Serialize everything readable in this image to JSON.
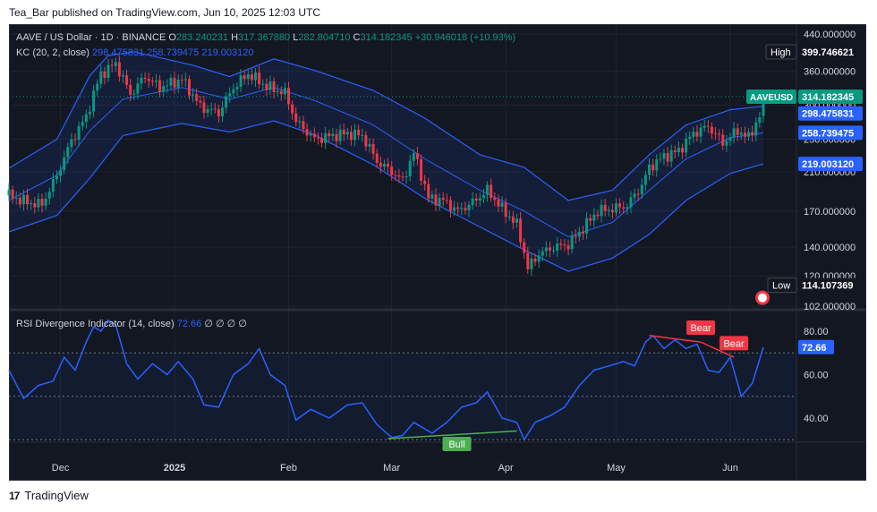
{
  "header": {
    "published": "Tea_Bar published on TradingView.com, Jun 10, 2025 12:03 UTC"
  },
  "main_legend": {
    "symbol": "AAVE / US Dollar · 1D · BINANCE",
    "o_label": "O",
    "o": "283.240231",
    "h_label": "H",
    "h": "317.367880",
    "l_label": "L",
    "l": "282.804710",
    "c_label": "C",
    "c": "314.182345",
    "change": "+30.946018 (+10.93%)",
    "kc_label": "KC (20, 2, close)",
    "kc_upper": "298.475831",
    "kc_mid": "258.739475",
    "kc_lower": "219.003120"
  },
  "rsi_legend": {
    "label": "RSI Divergence Indicator (14, close)",
    "value": "72.66",
    "extras": "∅ ∅ ∅ ∅"
  },
  "badges": {
    "high_label": "High",
    "high_value": "399.746621",
    "symbol_tag": "AAVEUSD",
    "last_price": "314.182345",
    "kc_upper": "298.475831",
    "kc_mid": "258.739475",
    "kc_lower": "219.003120",
    "low_label": "Low",
    "low_value": "114.107369",
    "rsi_value": "72.66"
  },
  "annotations": {
    "bull": "Bull",
    "bear1": "Bear",
    "bear2": "Bear"
  },
  "colors": {
    "up": "#089981",
    "down": "#f23645",
    "kc": "#2962ff",
    "bg": "#131722",
    "grid": "#1f2330",
    "rsi": "#2962ff"
  },
  "footer": {
    "brand": "TradingView",
    "logo_text": "17"
  },
  "chart_data": [
    {
      "type": "candlestick",
      "title": "AAVE / US Dollar · 1D · BINANCE",
      "y_scale": "log",
      "y_ticks": [
        102,
        120,
        140,
        170,
        210,
        250,
        300,
        360,
        440
      ],
      "y_tick_labels": [
        "102.000000",
        "120.000000",
        "140.000000",
        "170.000000",
        "210.000000",
        "250.000000",
        "300.000000",
        "360.000000",
        "440.000000"
      ],
      "x_ticks": [
        {
          "label": "Dec",
          "date": "2024-12-01"
        },
        {
          "label": "2025",
          "date": "2025-01-01"
        },
        {
          "label": "Feb",
          "date": "2025-02-01"
        },
        {
          "label": "Mar",
          "date": "2025-03-01"
        },
        {
          "label": "Apr",
          "date": "2025-04-01"
        },
        {
          "label": "May",
          "date": "2025-05-01"
        },
        {
          "label": "Jun",
          "date": "2025-06-01"
        }
      ],
      "x_range": [
        "2024-11-17",
        "2025-06-19"
      ],
      "close_path": [
        {
          "date": "2024-11-17",
          "close": 185
        },
        {
          "date": "2024-11-22",
          "close": 178
        },
        {
          "date": "2024-11-26",
          "close": 176
        },
        {
          "date": "2024-11-30",
          "close": 205
        },
        {
          "date": "2024-12-04",
          "close": 248
        },
        {
          "date": "2024-12-08",
          "close": 282
        },
        {
          "date": "2024-12-12",
          "close": 355
        },
        {
          "date": "2024-12-16",
          "close": 375
        },
        {
          "date": "2024-12-20",
          "close": 318
        },
        {
          "date": "2024-12-24",
          "close": 350
        },
        {
          "date": "2024-12-28",
          "close": 330
        },
        {
          "date": "2025-01-03",
          "close": 345
        },
        {
          "date": "2025-01-08",
          "close": 298
        },
        {
          "date": "2025-01-13",
          "close": 288
        },
        {
          "date": "2025-01-17",
          "close": 330
        },
        {
          "date": "2025-01-21",
          "close": 355
        },
        {
          "date": "2025-01-26",
          "close": 332
        },
        {
          "date": "2025-01-31",
          "close": 320
        },
        {
          "date": "2025-02-03",
          "close": 275
        },
        {
          "date": "2025-02-08",
          "close": 250
        },
        {
          "date": "2025-02-13",
          "close": 255
        },
        {
          "date": "2025-02-17",
          "close": 258
        },
        {
          "date": "2025-02-21",
          "close": 255
        },
        {
          "date": "2025-02-25",
          "close": 222
        },
        {
          "date": "2025-03-01",
          "close": 210
        },
        {
          "date": "2025-03-04",
          "close": 200
        },
        {
          "date": "2025-03-07",
          "close": 232
        },
        {
          "date": "2025-03-11",
          "close": 182
        },
        {
          "date": "2025-03-15",
          "close": 180
        },
        {
          "date": "2025-03-19",
          "close": 170
        },
        {
          "date": "2025-03-23",
          "close": 178
        },
        {
          "date": "2025-03-27",
          "close": 190
        },
        {
          "date": "2025-03-31",
          "close": 172
        },
        {
          "date": "2025-04-04",
          "close": 158
        },
        {
          "date": "2025-04-07",
          "close": 125
        },
        {
          "date": "2025-04-10",
          "close": 135
        },
        {
          "date": "2025-04-14",
          "close": 140
        },
        {
          "date": "2025-04-18",
          "close": 142
        },
        {
          "date": "2025-04-22",
          "close": 155
        },
        {
          "date": "2025-04-26",
          "close": 170
        },
        {
          "date": "2025-04-30",
          "close": 172
        },
        {
          "date": "2025-05-04",
          "close": 175
        },
        {
          "date": "2025-05-08",
          "close": 195
        },
        {
          "date": "2025-05-10",
          "close": 215
        },
        {
          "date": "2025-05-14",
          "close": 228
        },
        {
          "date": "2025-05-18",
          "close": 235
        },
        {
          "date": "2025-05-22",
          "close": 258
        },
        {
          "date": "2025-05-26",
          "close": 268
        },
        {
          "date": "2025-05-30",
          "close": 245
        },
        {
          "date": "2025-06-03",
          "close": 262
        },
        {
          "date": "2025-06-06",
          "close": 252
        },
        {
          "date": "2025-06-09",
          "close": 283
        },
        {
          "date": "2025-06-10",
          "close": 314
        }
      ],
      "kc_upper_path": [
        {
          "date": "2024-11-17",
          "value": 214
        },
        {
          "date": "2024-11-30",
          "value": 250
        },
        {
          "date": "2024-12-09",
          "value": 352
        },
        {
          "date": "2024-12-14",
          "value": 392
        },
        {
          "date": "2024-12-21",
          "value": 400
        },
        {
          "date": "2025-01-06",
          "value": 372
        },
        {
          "date": "2025-01-16",
          "value": 350
        },
        {
          "date": "2025-01-28",
          "value": 385
        },
        {
          "date": "2025-02-08",
          "value": 362
        },
        {
          "date": "2025-02-24",
          "value": 325
        },
        {
          "date": "2025-03-10",
          "value": 280
        },
        {
          "date": "2025-03-25",
          "value": 230
        },
        {
          "date": "2025-04-06",
          "value": 215
        },
        {
          "date": "2025-04-18",
          "value": 180
        },
        {
          "date": "2025-04-30",
          "value": 190
        },
        {
          "date": "2025-05-10",
          "value": 230
        },
        {
          "date": "2025-05-20",
          "value": 270
        },
        {
          "date": "2025-06-01",
          "value": 293
        },
        {
          "date": "2025-06-10",
          "value": 298.48
        }
      ],
      "kc_mid_path": [
        {
          "date": "2024-11-17",
          "value": 180
        },
        {
          "date": "2024-11-30",
          "value": 206
        },
        {
          "date": "2024-12-09",
          "value": 262
        },
        {
          "date": "2024-12-18",
          "value": 310
        },
        {
          "date": "2025-01-03",
          "value": 330
        },
        {
          "date": "2025-01-16",
          "value": 310
        },
        {
          "date": "2025-01-28",
          "value": 330
        },
        {
          "date": "2025-02-08",
          "value": 308
        },
        {
          "date": "2025-02-24",
          "value": 270
        },
        {
          "date": "2025-03-10",
          "value": 225
        },
        {
          "date": "2025-03-25",
          "value": 190
        },
        {
          "date": "2025-04-06",
          "value": 170
        },
        {
          "date": "2025-04-18",
          "value": 148
        },
        {
          "date": "2025-04-30",
          "value": 160
        },
        {
          "date": "2025-05-10",
          "value": 190
        },
        {
          "date": "2025-05-20",
          "value": 225
        },
        {
          "date": "2025-06-01",
          "value": 252
        },
        {
          "date": "2025-06-10",
          "value": 258.74
        }
      ],
      "kc_lower_path": [
        {
          "date": "2024-11-17",
          "value": 152
        },
        {
          "date": "2024-11-30",
          "value": 166
        },
        {
          "date": "2024-12-09",
          "value": 203
        },
        {
          "date": "2024-12-18",
          "value": 255
        },
        {
          "date": "2025-01-03",
          "value": 272
        },
        {
          "date": "2025-01-16",
          "value": 260
        },
        {
          "date": "2025-01-28",
          "value": 276
        },
        {
          "date": "2025-02-08",
          "value": 256
        },
        {
          "date": "2025-02-24",
          "value": 218
        },
        {
          "date": "2025-03-10",
          "value": 182
        },
        {
          "date": "2025-03-25",
          "value": 156
        },
        {
          "date": "2025-04-06",
          "value": 138
        },
        {
          "date": "2025-04-18",
          "value": 123
        },
        {
          "date": "2025-04-30",
          "value": 132
        },
        {
          "date": "2025-05-10",
          "value": 150
        },
        {
          "date": "2025-05-20",
          "value": 180
        },
        {
          "date": "2025-06-01",
          "value": 208
        },
        {
          "date": "2025-06-10",
          "value": 219.0
        }
      ],
      "high": 399.746621,
      "low": 114.107369,
      "last": 314.182345
    },
    {
      "type": "line",
      "title": "RSI Divergence Indicator (14, close)",
      "ylim": [
        25,
        87
      ],
      "y_ticks": [
        40,
        60,
        80
      ],
      "y_tick_labels": [
        "40.00",
        "60.00",
        "80.00"
      ],
      "bands": [
        30,
        50,
        70
      ],
      "rsi_path": [
        {
          "date": "2024-11-17",
          "value": 62
        },
        {
          "date": "2024-11-21",
          "value": 49
        },
        {
          "date": "2024-11-25",
          "value": 55
        },
        {
          "date": "2024-11-29",
          "value": 57
        },
        {
          "date": "2024-12-02",
          "value": 68
        },
        {
          "date": "2024-12-05",
          "value": 62
        },
        {
          "date": "2024-12-08",
          "value": 75
        },
        {
          "date": "2024-12-10",
          "value": 82
        },
        {
          "date": "2024-12-12",
          "value": 80
        },
        {
          "date": "2024-12-14",
          "value": 85
        },
        {
          "date": "2024-12-16",
          "value": 83
        },
        {
          "date": "2024-12-19",
          "value": 65
        },
        {
          "date": "2024-12-22",
          "value": 58
        },
        {
          "date": "2024-12-26",
          "value": 65
        },
        {
          "date": "2024-12-30",
          "value": 60
        },
        {
          "date": "2025-01-02",
          "value": 66
        },
        {
          "date": "2025-01-06",
          "value": 58
        },
        {
          "date": "2025-01-09",
          "value": 46
        },
        {
          "date": "2025-01-13",
          "value": 45
        },
        {
          "date": "2025-01-17",
          "value": 60
        },
        {
          "date": "2025-01-21",
          "value": 65
        },
        {
          "date": "2025-01-24",
          "value": 72
        },
        {
          "date": "2025-01-27",
          "value": 60
        },
        {
          "date": "2025-01-31",
          "value": 55
        },
        {
          "date": "2025-02-03",
          "value": 39
        },
        {
          "date": "2025-02-07",
          "value": 44
        },
        {
          "date": "2025-02-12",
          "value": 40
        },
        {
          "date": "2025-02-17",
          "value": 46
        },
        {
          "date": "2025-02-21",
          "value": 47
        },
        {
          "date": "2025-02-25",
          "value": 37
        },
        {
          "date": "2025-03-01",
          "value": 31
        },
        {
          "date": "2025-03-04",
          "value": 32
        },
        {
          "date": "2025-03-07",
          "value": 38
        },
        {
          "date": "2025-03-12",
          "value": 33
        },
        {
          "date": "2025-03-16",
          "value": 38
        },
        {
          "date": "2025-03-20",
          "value": 45
        },
        {
          "date": "2025-03-24",
          "value": 47
        },
        {
          "date": "2025-03-27",
          "value": 52
        },
        {
          "date": "2025-03-31",
          "value": 40
        },
        {
          "date": "2025-04-04",
          "value": 38
        },
        {
          "date": "2025-04-06",
          "value": 30
        },
        {
          "date": "2025-04-09",
          "value": 38
        },
        {
          "date": "2025-04-13",
          "value": 41
        },
        {
          "date": "2025-04-17",
          "value": 45
        },
        {
          "date": "2025-04-21",
          "value": 55
        },
        {
          "date": "2025-04-25",
          "value": 62
        },
        {
          "date": "2025-04-29",
          "value": 64
        },
        {
          "date": "2025-05-03",
          "value": 66
        },
        {
          "date": "2025-05-06",
          "value": 64
        },
        {
          "date": "2025-05-09",
          "value": 75
        },
        {
          "date": "2025-05-11",
          "value": 78
        },
        {
          "date": "2025-05-14",
          "value": 72
        },
        {
          "date": "2025-05-17",
          "value": 76
        },
        {
          "date": "2025-05-20",
          "value": 72
        },
        {
          "date": "2025-05-23",
          "value": 74
        },
        {
          "date": "2025-05-26",
          "value": 62
        },
        {
          "date": "2025-05-29",
          "value": 61
        },
        {
          "date": "2025-06-01",
          "value": 68
        },
        {
          "date": "2025-06-04",
          "value": 50
        },
        {
          "date": "2025-06-07",
          "value": 56
        },
        {
          "date": "2025-06-10",
          "value": 72.66
        }
      ],
      "divergences": [
        {
          "kind": "Bull",
          "from": {
            "date": "2025-02-28",
            "value": 30.5
          },
          "to": {
            "date": "2025-04-04",
            "value": 34
          }
        },
        {
          "kind": "Bear",
          "from": {
            "date": "2025-05-10",
            "value": 78
          },
          "to": {
            "date": "2025-05-24",
            "value": 75
          }
        },
        {
          "kind": "Bear",
          "from": {
            "date": "2025-05-24",
            "value": 75
          },
          "to": {
            "date": "2025-06-02",
            "value": 68
          }
        }
      ]
    }
  ]
}
